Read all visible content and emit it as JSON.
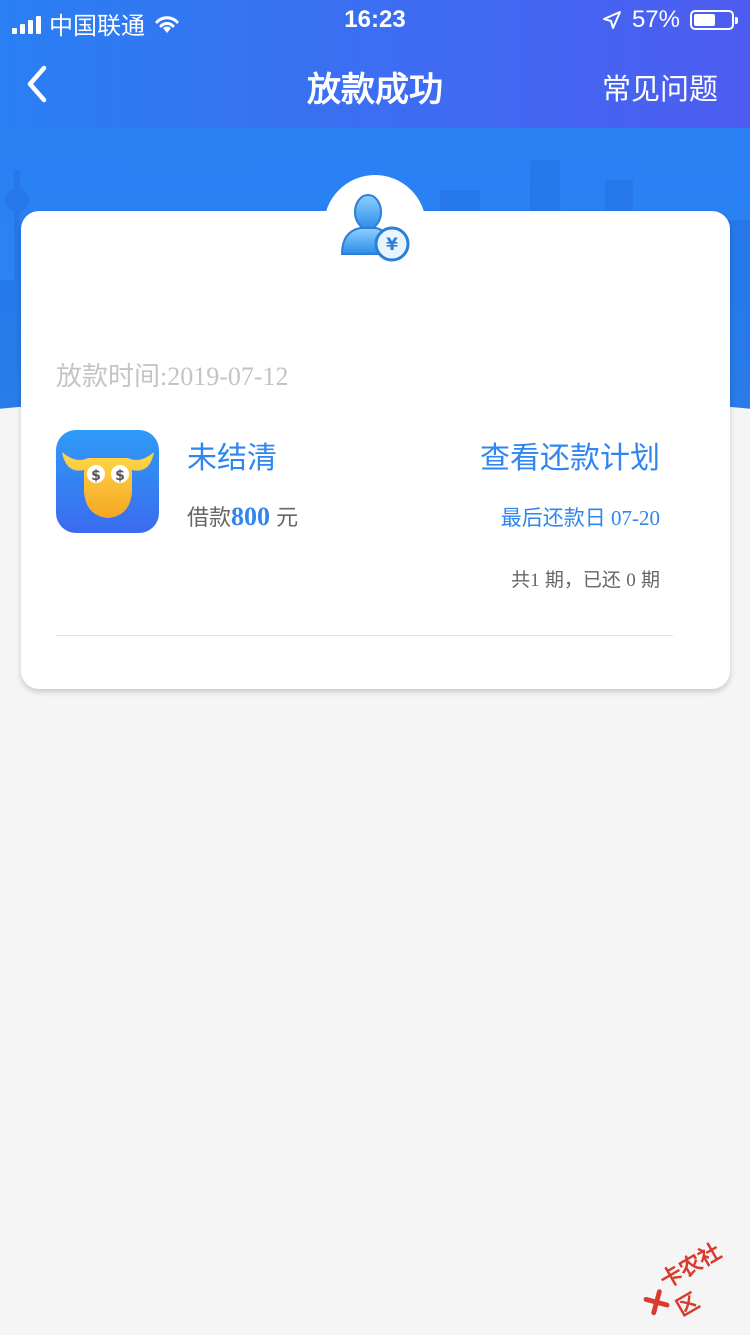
{
  "status_bar": {
    "carrier": "中国联通",
    "time": "16:23",
    "battery_percent": "57%",
    "battery_level": 0.57
  },
  "nav": {
    "title": "放款成功",
    "faq_label": "常见问题",
    "back_icon": "chevron-left-icon"
  },
  "theme": {
    "primary": "#2f86f0",
    "nav_gradient_start": "#2a7ff3",
    "nav_gradient_end": "#4d5cf0",
    "muted_text": "#c4c4c4"
  },
  "loan": {
    "time_label": "放款时间:2019-07-12",
    "status": "未结清",
    "amount_prefix": "借款",
    "amount": "800",
    "amount_unit": " 元",
    "view_plan_label": "查看还款计划",
    "last_day_label": "最后还款日",
    "last_day_date": " 07-20",
    "periods_text_a": "共",
    "periods_total": "1",
    "periods_text_b": " 期，已还 ",
    "periods_paid": "0",
    "periods_text_c": " 期"
  },
  "watermark": {
    "text": "卡农社区"
  }
}
